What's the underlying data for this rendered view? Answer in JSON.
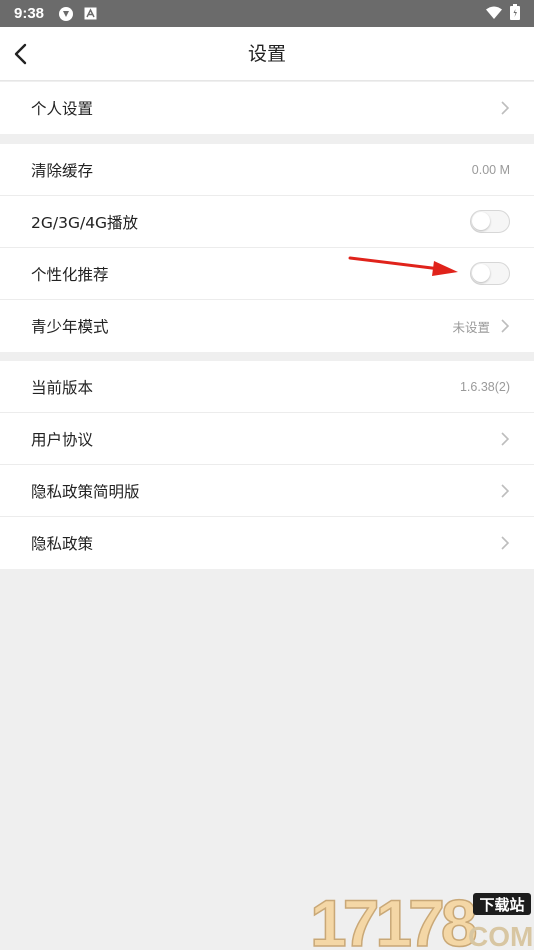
{
  "status_bar": {
    "time": "9:38"
  },
  "nav": {
    "title": "设置"
  },
  "groups": [
    {
      "items": [
        {
          "label": "个人设置"
        }
      ]
    },
    {
      "items": [
        {
          "label": "清除缓存",
          "value": "0.00 M"
        },
        {
          "label": "2G/3G/4G播放",
          "toggle": false
        },
        {
          "label": "个性化推荐",
          "toggle": false
        },
        {
          "label": "青少年模式",
          "value": "未设置"
        }
      ]
    },
    {
      "items": [
        {
          "label": "当前版本",
          "value": "1.6.38(2)"
        },
        {
          "label": "用户协议"
        },
        {
          "label": "隐私政策简明版"
        },
        {
          "label": "隐私政策"
        }
      ]
    }
  ],
  "watermark": {
    "text": "17178",
    "badge": "下载站",
    "suffix": "COM"
  },
  "colors": {
    "status_bar": "#6b6b6b",
    "page_bg": "#efefef",
    "annotation_arrow": "#e0231b"
  }
}
